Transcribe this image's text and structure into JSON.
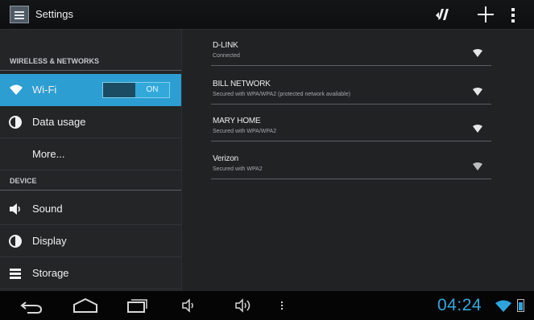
{
  "app": {
    "title": "Settings",
    "icon": "settings-app-icon"
  },
  "action_bar": {
    "actions": [
      {
        "icon": "wps-sync-icon"
      },
      {
        "icon": "add-network-icon"
      },
      {
        "icon": "overflow-menu-icon"
      }
    ]
  },
  "sidebar": {
    "sections": [
      {
        "header": "WIRELESS & NETWORKS"
      },
      {
        "header": "DEVICE"
      }
    ],
    "items": [
      {
        "label": "Wi-Fi",
        "icon": "wifi-icon",
        "selected": true,
        "toggle": "ON"
      },
      {
        "label": "Data usage",
        "icon": "data-usage-icon"
      },
      {
        "label": "More..."
      },
      {
        "label": "Sound",
        "icon": "sound-icon"
      },
      {
        "label": "Display",
        "icon": "display-icon"
      },
      {
        "label": "Storage",
        "icon": "storage-icon"
      }
    ]
  },
  "networks": [
    {
      "name": "D-LINK",
      "status": "Connected",
      "icon": "wifi-signal-icon"
    },
    {
      "name": "BILL NETWORK",
      "status": "Secured with WPA/WPA2 (protected network available)",
      "icon": "wifi-signal-icon"
    },
    {
      "name": "MARY HOME",
      "status": "Secured with WPA/WPA2",
      "icon": "wifi-signal-icon"
    },
    {
      "name": "Verizon",
      "status": "Secured with WPA2",
      "icon": "wifi-signal-icon"
    }
  ],
  "system_bar": {
    "time": "04:24",
    "buttons": [
      "back-icon",
      "home-icon",
      "recent-apps-icon",
      "volume-down-icon",
      "volume-up-icon",
      "menu-icon"
    ],
    "status_icons": [
      "wifi-status-icon",
      "battery-icon"
    ]
  },
  "colors": {
    "accent": "#33b5e5",
    "selected_bg": "#2d9ed1",
    "clock": "#34a9df"
  }
}
